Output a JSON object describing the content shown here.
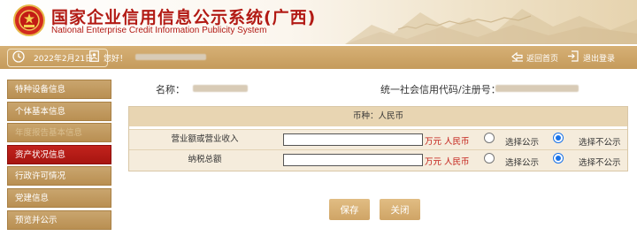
{
  "header": {
    "title_cn": "国家企业信用信息公示系统(广西)",
    "title_en": "National Enterprise Credit Information Publicity System"
  },
  "topbar": {
    "date": "2022年2月21日",
    "greeting": "您好！",
    "home_link": "返回首页",
    "logout_link": "退出登录"
  },
  "sidebar": {
    "items": [
      {
        "label": "特种设备信息",
        "state": "normal"
      },
      {
        "label": "个体基本信息",
        "state": "normal"
      },
      {
        "label": "年度报告基本信息",
        "state": "dim"
      },
      {
        "label": "资产状况信息",
        "state": "active"
      },
      {
        "label": "行政许可情况",
        "state": "normal"
      },
      {
        "label": "党建信息",
        "state": "normal"
      },
      {
        "label": "预览并公示",
        "state": "normal"
      }
    ]
  },
  "info": {
    "name_label": "名称：",
    "credit_code_label": "统一社会信用代码/注册号："
  },
  "table": {
    "currency_header": "币种：人民币",
    "rows": [
      {
        "label": "营业额或营业收入",
        "value": "",
        "unit": "万元 人民币",
        "option_public": "选择公示",
        "option_private": "选择不公示",
        "selected": "private"
      },
      {
        "label": "纳税总额",
        "value": "",
        "unit": "万元 人民币",
        "option_public": "选择公示",
        "option_private": "选择不公示",
        "selected": "private"
      }
    ]
  },
  "buttons": {
    "save": "保存",
    "close": "关闭"
  },
  "colors": {
    "brand_red": "#b21a14",
    "gold": "#c59b5c",
    "active_red": "#a71510",
    "radio_blue": "#1a73e8"
  }
}
